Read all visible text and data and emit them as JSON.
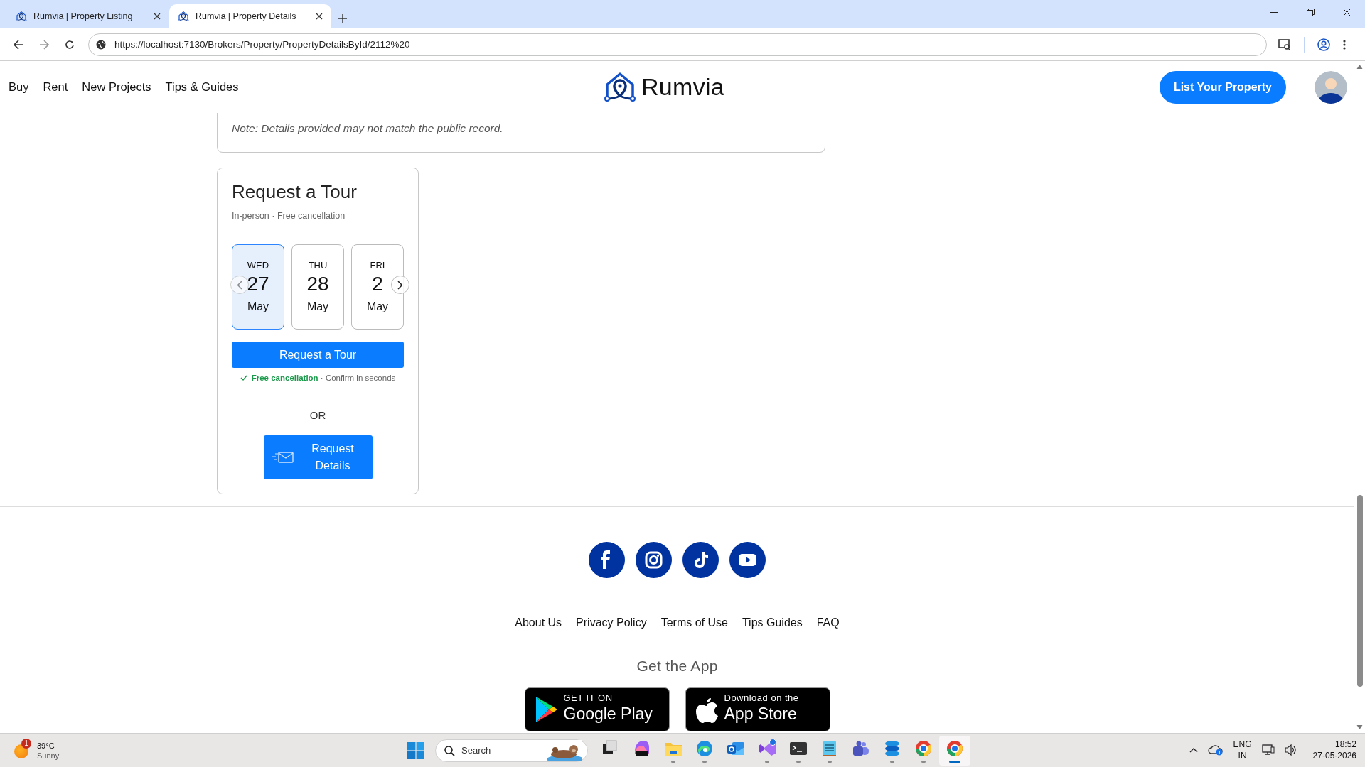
{
  "browser": {
    "tabs": [
      {
        "title": "Rumvia | Property Listing",
        "selected": false
      },
      {
        "title": "Rumvia | Property Details",
        "selected": true
      }
    ],
    "url": "https://localhost:7130/Brokers/Property/PropertyDetailsById/2112%20"
  },
  "nav": {
    "links": [
      "Buy",
      "Rent",
      "New Projects",
      "Tips & Guides"
    ],
    "brand": "Rumvia",
    "cta": "List Your Property"
  },
  "note": "Note: Details provided may not match the public record.",
  "tour": {
    "title": "Request a Tour",
    "subtitle": "In-person · Free cancellation",
    "dates": [
      {
        "weekday": "WED",
        "day": "27",
        "month": "May",
        "selected": true
      },
      {
        "weekday": "THU",
        "day": "28",
        "month": "May",
        "selected": false
      },
      {
        "weekday": "FRI",
        "day": "2",
        "month": "May",
        "selected": false
      }
    ],
    "button": "Request a Tour",
    "assurance": "**Free cancellation** · Confirm in seconds",
    "separator": "OR",
    "details_button": "Request Details"
  },
  "footer": {
    "social": [
      {
        "kind": "facebook"
      },
      {
        "kind": "instagram"
      },
      {
        "kind": "tiktok"
      },
      {
        "kind": "youtube"
      }
    ],
    "links": [
      "About Us",
      "Privacy Policy",
      "Terms of Use",
      "Tips Guides",
      "FAQ"
    ],
    "app_heading": "Get the App",
    "badges": [
      {
        "kind": "google",
        "small": "GET IT ON",
        "big": "Google Play"
      },
      {
        "kind": "apple",
        "small": "Download on the",
        "big": "App Store"
      }
    ]
  },
  "taskbar": {
    "weather": {
      "temp": "39°C",
      "condition": "Sunny",
      "badge": "1"
    },
    "search": {
      "placeholder": "Search"
    },
    "apps": [
      {
        "kind": "taskview",
        "running": false,
        "selected": false
      },
      {
        "kind": "m365",
        "running": false,
        "selected": false
      },
      {
        "kind": "explorer",
        "running": true,
        "selected": false
      },
      {
        "kind": "edge",
        "running": true,
        "selected": false
      },
      {
        "kind": "outlook",
        "running": false,
        "selected": false
      },
      {
        "kind": "vs",
        "running": true,
        "selected": false
      },
      {
        "kind": "terminal",
        "running": true,
        "selected": false
      },
      {
        "kind": "notepad",
        "running": true,
        "selected": false
      },
      {
        "kind": "teams",
        "running": false,
        "selected": false
      },
      {
        "kind": "stack",
        "running": true,
        "selected": false
      },
      {
        "kind": "chrome",
        "running": true,
        "selected": false
      },
      {
        "kind": "chrome",
        "running": true,
        "selected": true
      }
    ],
    "tray": {
      "language": "ENG",
      "region": "IN",
      "time": "18:52",
      "date": "27-05-2026"
    }
  }
}
